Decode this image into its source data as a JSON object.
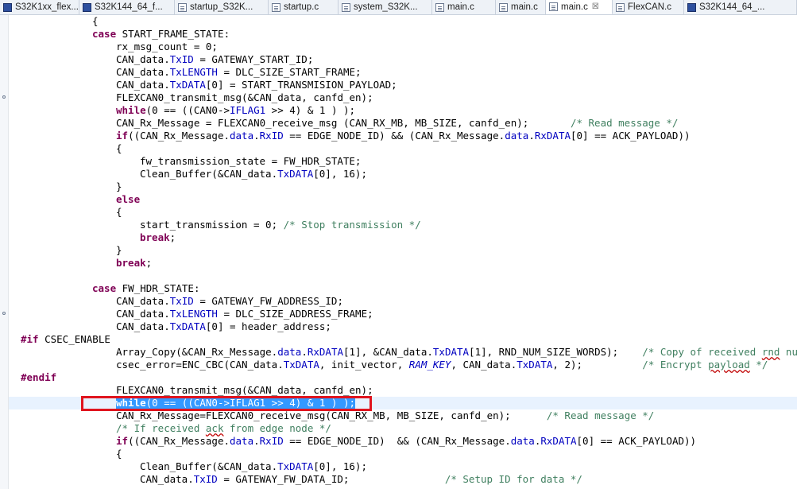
{
  "tabs": [
    {
      "label": "S32K1xx_flex...",
      "icon": "chip-icon",
      "active": false
    },
    {
      "label": "S32K144_64_f...",
      "icon": "chip-icon",
      "active": false
    },
    {
      "label": "startup_S32K...",
      "icon": "file-icon",
      "active": false
    },
    {
      "label": "startup.c",
      "icon": "file-icon",
      "active": false
    },
    {
      "label": "system_S32K...",
      "icon": "file-icon",
      "active": false
    },
    {
      "label": "main.c",
      "icon": "file-icon",
      "active": false
    },
    {
      "label": "main.c",
      "icon": "file-icon",
      "active": false
    },
    {
      "label": "main.c",
      "icon": "file-icon",
      "active": true,
      "close": "☒"
    },
    {
      "label": "FlexCAN.c",
      "icon": "file-icon",
      "active": false
    },
    {
      "label": "S32K144_64_...",
      "icon": "chip-icon",
      "active": false
    }
  ],
  "colors": {
    "keyword": "#7f0055",
    "field": "#0000c0",
    "comment": "#3f7f5f",
    "selection": "#3399ff",
    "highlight_box": "#e0141e"
  },
  "code": [
    {
      "indent": 12,
      "t": [
        [
          "{",
          "p"
        ]
      ]
    },
    {
      "indent": 12,
      "t": [
        [
          "case",
          "kw"
        ],
        [
          " START_FRAME_STATE:",
          "p"
        ]
      ]
    },
    {
      "indent": 16,
      "t": [
        [
          "rx_msg_count = 0;",
          "p"
        ]
      ]
    },
    {
      "indent": 16,
      "t": [
        [
          "CAN_data.",
          "p"
        ],
        [
          "TxID",
          "fld"
        ],
        [
          " = GATEWAY_START_ID;",
          "p"
        ]
      ]
    },
    {
      "indent": 16,
      "t": [
        [
          "CAN_data.",
          "p"
        ],
        [
          "TxLENGTH",
          "fld"
        ],
        [
          " = DLC_SIZE_START_FRAME;",
          "p"
        ]
      ]
    },
    {
      "indent": 16,
      "t": [
        [
          "CAN_data.",
          "p"
        ],
        [
          "TxDATA",
          "fld"
        ],
        [
          "[0] = START_TRANSMISION_PAYLOAD;",
          "p"
        ]
      ]
    },
    {
      "indent": 16,
      "t": [
        [
          "FLEXCAN0_transmit_msg(&CAN_data, canfd_en);",
          "p"
        ]
      ]
    },
    {
      "indent": 16,
      "t": [
        [
          "while",
          "kw"
        ],
        [
          "(0 == ((CAN0->",
          "p"
        ],
        [
          "IFLAG1",
          "fld"
        ],
        [
          " >> 4) & 1 ) );",
          "p"
        ]
      ]
    },
    {
      "indent": 16,
      "t": [
        [
          "CAN_Rx_Message = FLEXCAN0_receive_msg (CAN_RX_MB, MB_SIZE, canfd_en);       ",
          "p"
        ],
        [
          "/* Read message */",
          "cm"
        ]
      ]
    },
    {
      "indent": 16,
      "t": [
        [
          "if",
          "kw"
        ],
        [
          "((CAN_Rx_Message.",
          "p"
        ],
        [
          "data",
          "fld"
        ],
        [
          ".",
          "p"
        ],
        [
          "RxID",
          "fld"
        ],
        [
          " == EDGE_NODE_ID) && (CAN_Rx_Message.",
          "p"
        ],
        [
          "data",
          "fld"
        ],
        [
          ".",
          "p"
        ],
        [
          "RxDATA",
          "fld"
        ],
        [
          "[0] == ACK_PAYLOAD))",
          "p"
        ]
      ]
    },
    {
      "indent": 16,
      "t": [
        [
          "{",
          "p"
        ]
      ]
    },
    {
      "indent": 20,
      "t": [
        [
          "fw_transmission_state = FW_HDR_STATE;",
          "p"
        ]
      ]
    },
    {
      "indent": 20,
      "t": [
        [
          "Clean_Buffer(&CAN_data.",
          "p"
        ],
        [
          "TxDATA",
          "fld"
        ],
        [
          "[0], 16);",
          "p"
        ]
      ]
    },
    {
      "indent": 16,
      "t": [
        [
          "}",
          "p"
        ]
      ]
    },
    {
      "indent": 16,
      "t": [
        [
          "else",
          "kw"
        ]
      ]
    },
    {
      "indent": 16,
      "t": [
        [
          "{",
          "p"
        ]
      ]
    },
    {
      "indent": 20,
      "t": [
        [
          "start_transmission = 0; ",
          "p"
        ],
        [
          "/* Stop transmission */",
          "cm"
        ]
      ]
    },
    {
      "indent": 20,
      "t": [
        [
          "break",
          "kw"
        ],
        [
          ";",
          "p"
        ]
      ]
    },
    {
      "indent": 16,
      "t": [
        [
          "}",
          "p"
        ]
      ]
    },
    {
      "indent": 16,
      "t": [
        [
          "break",
          "kw"
        ],
        [
          ";",
          "p"
        ]
      ]
    },
    {
      "indent": 0,
      "t": []
    },
    {
      "indent": 12,
      "t": [
        [
          "case",
          "kw"
        ],
        [
          " FW_HDR_STATE:",
          "p"
        ]
      ]
    },
    {
      "indent": 16,
      "t": [
        [
          "CAN_data.",
          "p"
        ],
        [
          "TxID",
          "fld"
        ],
        [
          " = GATEWAY_FW_ADDRESS_ID;",
          "p"
        ]
      ]
    },
    {
      "indent": 16,
      "t": [
        [
          "CAN_data.",
          "p"
        ],
        [
          "TxLENGTH",
          "fld"
        ],
        [
          " = DLC_SIZE_ADDRESS_FRAME;",
          "p"
        ]
      ]
    },
    {
      "indent": 16,
      "t": [
        [
          "CAN_data.",
          "p"
        ],
        [
          "TxDATA",
          "fld"
        ],
        [
          "[0] = header_address;",
          "p"
        ]
      ]
    },
    {
      "indent": 0,
      "t": [
        [
          "#if",
          "pp"
        ],
        [
          " CSEC_ENABLE",
          "p"
        ]
      ]
    },
    {
      "indent": 16,
      "t": [
        [
          "Array_Copy(&CAN_Rx_Message.",
          "p"
        ],
        [
          "data",
          "fld"
        ],
        [
          ".",
          "p"
        ],
        [
          "RxDATA",
          "fld"
        ],
        [
          "[1], &CAN_data.",
          "p"
        ],
        [
          "TxDATA",
          "fld"
        ],
        [
          "[1], RND_NUM_SIZE_WORDS);    ",
          "p"
        ],
        [
          "/* Copy of received ",
          "cm"
        ],
        [
          "rnd",
          "cm squig"
        ],
        [
          " number to",
          "cm"
        ]
      ]
    },
    {
      "indent": 16,
      "t": [
        [
          "csec_error=ENC_CBC(CAN_data.",
          "p"
        ],
        [
          "TxDATA",
          "fld"
        ],
        [
          ", init_vector, ",
          "p"
        ],
        [
          "RAM_KEY",
          "it"
        ],
        [
          ", CAN_data.",
          "p"
        ],
        [
          "TxDATA",
          "fld"
        ],
        [
          ", 2);          ",
          "p"
        ],
        [
          "/* Encrypt ",
          "cm"
        ],
        [
          "payload",
          "cm squig"
        ],
        [
          " */",
          "cm"
        ]
      ]
    },
    {
      "indent": 0,
      "t": [
        [
          "#endif",
          "pp"
        ]
      ]
    },
    {
      "indent": 16,
      "t": [
        [
          "FLEXCAN0_transmit_msg(&CAN_data, canfd_en);",
          "p"
        ]
      ]
    },
    {
      "indent": 16,
      "cur": true,
      "t": [
        [
          "while",
          "kw sel"
        ],
        [
          "(0 == ((CAN0->IFLAG1 >> 4) & 1 ) );",
          "sel"
        ]
      ]
    },
    {
      "indent": 16,
      "t": [
        [
          "CAN_Rx_Message=FLEXCAN0_receive_msg(CAN_RX_MB, MB_SIZE, canfd_en);      ",
          "p"
        ],
        [
          "/* Read message */",
          "cm"
        ]
      ]
    },
    {
      "indent": 16,
      "t": [
        [
          "/* If received ",
          "cm"
        ],
        [
          "ack",
          "cm squig"
        ],
        [
          " from edge node */",
          "cm"
        ]
      ]
    },
    {
      "indent": 16,
      "t": [
        [
          "if",
          "kw"
        ],
        [
          "((CAN_Rx_Message.",
          "p"
        ],
        [
          "data",
          "fld"
        ],
        [
          ".",
          "p"
        ],
        [
          "RxID",
          "fld"
        ],
        [
          " == EDGE_NODE_ID)  && (CAN_Rx_Message.",
          "p"
        ],
        [
          "data",
          "fld"
        ],
        [
          ".",
          "p"
        ],
        [
          "RxDATA",
          "fld"
        ],
        [
          "[0] == ACK_PAYLOAD))",
          "p"
        ]
      ]
    },
    {
      "indent": 16,
      "t": [
        [
          "{",
          "p"
        ]
      ]
    },
    {
      "indent": 20,
      "t": [
        [
          "Clean_Buffer(&CAN_data.",
          "p"
        ],
        [
          "TxDATA",
          "fld"
        ],
        [
          "[0], 16);",
          "p"
        ]
      ]
    },
    {
      "indent": 20,
      "t": [
        [
          "CAN_data.",
          "p"
        ],
        [
          "TxID",
          "fld"
        ],
        [
          " = GATEWAY_FW_DATA_ID;                ",
          "p"
        ],
        [
          "/* Setup ID for data */",
          "cm"
        ]
      ]
    }
  ]
}
